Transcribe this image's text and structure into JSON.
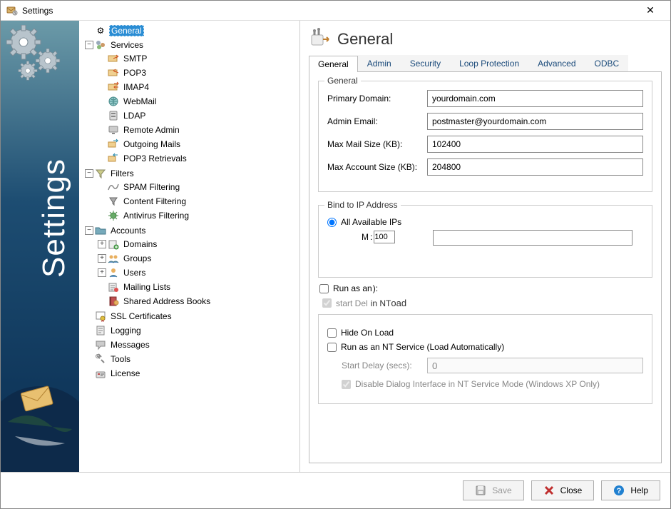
{
  "window": {
    "title": "Settings"
  },
  "banner": {
    "text": "Settings"
  },
  "tree": {
    "general": "General",
    "services": "Services",
    "smtp": "SMTP",
    "pop3": "POP3",
    "imap4": "IMAP4",
    "webmail": "WebMail",
    "ldap": "LDAP",
    "remote_admin": "Remote Admin",
    "outgoing": "Outgoing Mails",
    "pop3_ret": "POP3 Retrievals",
    "filters": "Filters",
    "spam": "SPAM Filtering",
    "content": "Content Filtering",
    "antivirus": "Antivirus Filtering",
    "accounts": "Accounts",
    "domains": "Domains",
    "groups": "Groups",
    "users": "Users",
    "mailing": "Mailing Lists",
    "shared": "Shared Address Books",
    "ssl": "SSL Certificates",
    "logging": "Logging",
    "messages": "Messages",
    "tools": "Tools",
    "license": "License"
  },
  "header": {
    "title": "General"
  },
  "tabs": {
    "general": "General",
    "admin": "Admin",
    "security": "Security",
    "loop": "Loop Protection",
    "advanced": "Advanced",
    "odbc": "ODBC"
  },
  "group_general": {
    "legend": "General",
    "primary_domain_label": "Primary Domain:",
    "primary_domain_value": "yourdomain.com",
    "admin_email_label": "Admin Email:",
    "admin_email_value": "postmaster@yourdomain.com",
    "max_mail_label": "Max Mail Size (KB):",
    "max_mail_value": "102400",
    "max_acct_label": "Max Account Size (KB):",
    "max_acct_value": "204800"
  },
  "group_bind": {
    "legend": "Bind to IP Address",
    "radio_all": "All Available IPs",
    "glitch_prefix": "M",
    "glitch_val": "100"
  },
  "group_ntservice": {
    "run_as_fragment": "Run as an",
    "start_del_fragment": "start Del",
    "in_nt_fragment": "in NT",
    "oad_fragment": "oad",
    "hide_on_load": "Hide On Load",
    "run_as_service": "Run as an NT Service (Load Automatically)",
    "start_delay_label": "Start Delay (secs):",
    "start_delay_value": "0",
    "disable_dialog": "Disable Dialog Interface in NT Service Mode (Windows XP Only)"
  },
  "buttons": {
    "save": "Save",
    "close": "Close",
    "help": "Help"
  }
}
